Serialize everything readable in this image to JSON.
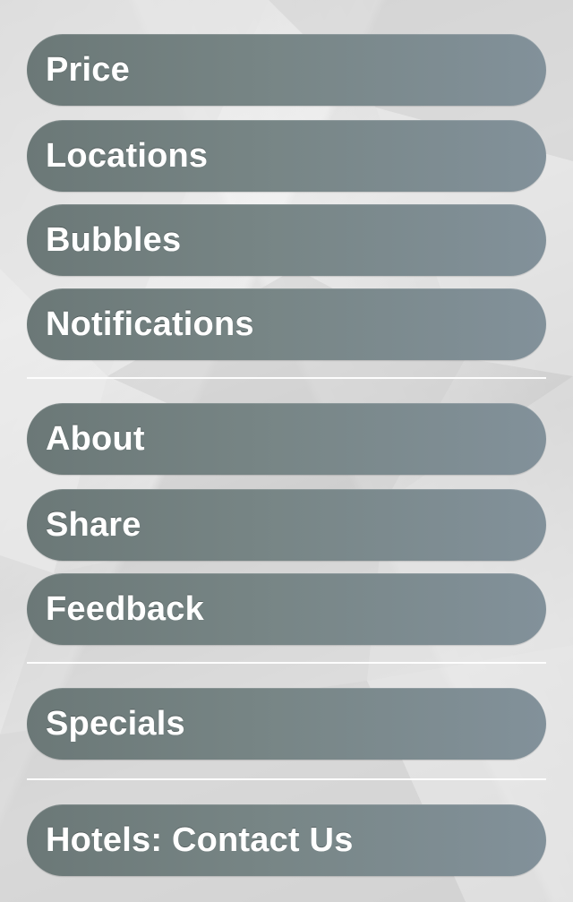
{
  "menu": {
    "group1": {
      "price": "Price",
      "locations": "Locations",
      "bubbles": "Bubbles",
      "notifications": "Notifications"
    },
    "group2": {
      "about": "About",
      "share": "Share",
      "feedback": "Feedback"
    },
    "group3": {
      "specials": "Specials"
    },
    "group4": {
      "hotels_contact": "Hotels: Contact Us"
    }
  },
  "colors": {
    "button_start": "#6b7877",
    "button_end": "#82919a",
    "label": "#ffffff",
    "divider": "#ffffff",
    "background": "#dcdcdc"
  }
}
